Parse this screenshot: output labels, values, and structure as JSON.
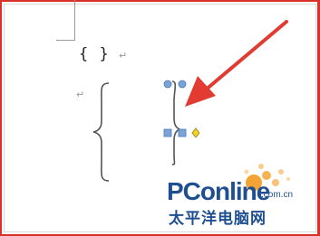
{
  "document": {
    "brace_pair_text": "{ }",
    "paragraph_mark": "↵"
  },
  "watermark": {
    "brand": "PConline",
    "domain": ".com.cn",
    "chinese_name": "太平洋电脑网"
  },
  "colors": {
    "frame_red": "#d9302a",
    "arrow_red": "#e23b32",
    "handle_blue": "#7aa3d8",
    "adjust_yellow": "#f5d324",
    "brand_blue": "#1f4f91",
    "brand_orange": "#f39a1e"
  }
}
